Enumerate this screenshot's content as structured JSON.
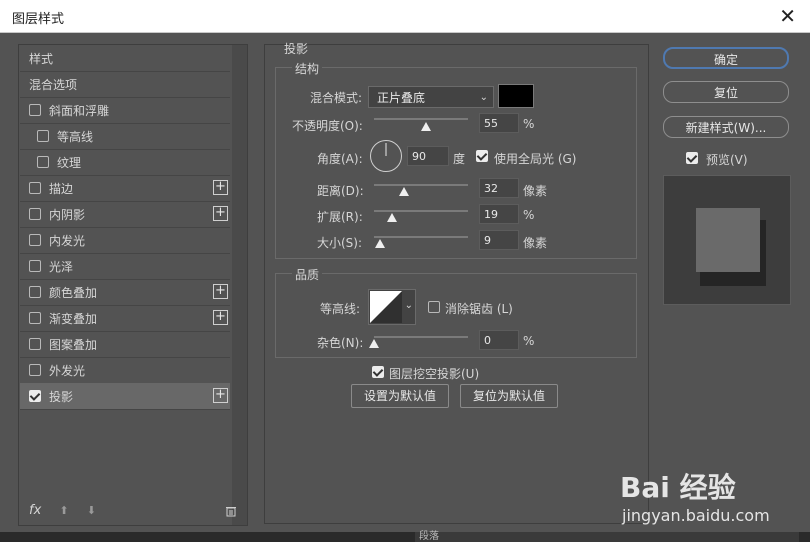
{
  "window": {
    "title": "图层样式",
    "close_glyph": "✕"
  },
  "left": {
    "items": [
      {
        "label": "样式",
        "type": "plain"
      },
      {
        "label": "混合选项",
        "type": "plain"
      },
      {
        "label": "斜面和浮雕",
        "type": "check",
        "checked": false
      },
      {
        "label": "等高线",
        "type": "check-indent",
        "checked": false
      },
      {
        "label": "纹理",
        "type": "check-indent",
        "checked": false
      },
      {
        "label": "描边",
        "type": "check",
        "checked": false,
        "plus": "+"
      },
      {
        "label": "内阴影",
        "type": "check",
        "checked": false,
        "plus": "+"
      },
      {
        "label": "内发光",
        "type": "check",
        "checked": false
      },
      {
        "label": "光泽",
        "type": "check",
        "checked": false
      },
      {
        "label": "颜色叠加",
        "type": "check",
        "checked": false,
        "plus": "+"
      },
      {
        "label": "渐变叠加",
        "type": "check",
        "checked": false,
        "plus": "+"
      },
      {
        "label": "图案叠加",
        "type": "check",
        "checked": false
      },
      {
        "label": "外发光",
        "type": "check",
        "checked": false
      },
      {
        "label": "投影",
        "type": "check",
        "checked": true,
        "plus": "+",
        "selected": true
      }
    ],
    "footer": {
      "fx": "fx",
      "up": "⬆",
      "down": "⬇",
      "trash_icon": "trash-icon"
    }
  },
  "section": {
    "title": "投影",
    "structure": "结构",
    "quality": "品质"
  },
  "structure": {
    "blend_label": "混合模式:",
    "blend_value": "正片叠底",
    "blend_color": "#000000",
    "opacity_label": "不透明度(O):",
    "opacity_value": "55",
    "opacity_unit": "%",
    "opacity_level": 0.55,
    "angle_label": "角度(A):",
    "angle_value": "90",
    "angle_unit": "度",
    "global_light_label": "使用全局光 (G)",
    "global_light_checked": true,
    "distance_label": "距离(D):",
    "distance_value": "32",
    "distance_unit": "像素",
    "distance_level": 0.32,
    "spread_label": "扩展(R):",
    "spread_value": "19",
    "spread_unit": "%",
    "spread_level": 0.19,
    "size_label": "大小(S):",
    "size_value": "9",
    "size_unit": "像素",
    "size_level": 0.06
  },
  "quality": {
    "contour_label": "等高线:",
    "antialias_label": "消除锯齿 (L)",
    "antialias_checked": false,
    "noise_label": "杂色(N):",
    "noise_value": "0",
    "noise_unit": "%",
    "noise_level": 0.0,
    "knockout_label": "图层挖空投影(U)",
    "knockout_checked": true,
    "set_default_label": "设置为默认值",
    "reset_default_label": "复位为默认值"
  },
  "right": {
    "ok_label": "确定",
    "reset_label": "复位",
    "new_style_label": "新建样式(W)...",
    "preview_label": "预览(V)",
    "preview_checked": true
  },
  "watermark": {
    "brand": "Bai 经验",
    "url": "jingyan.baidu.com"
  },
  "bottom": {
    "seg_label": "段落"
  },
  "colors": {
    "dialog_bg": "#535353",
    "accent": "#4f79b0",
    "titlebar": "#ffffff"
  }
}
